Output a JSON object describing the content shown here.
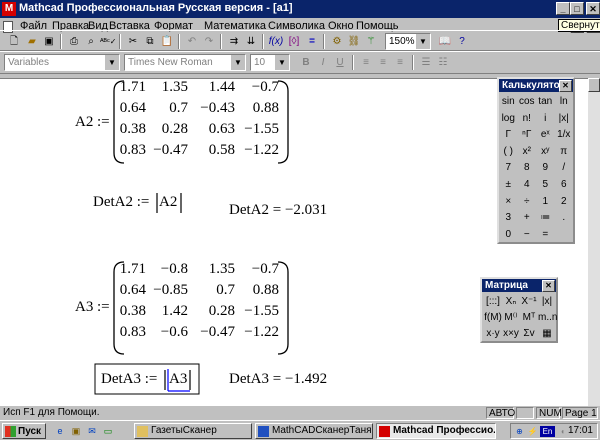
{
  "window": {
    "title": "Mathcad Профессиональная Русская версия - [a1]",
    "tooltip": "Свернуть"
  },
  "menu": [
    "Файл",
    "Правка",
    "Вид",
    "Вставка",
    "Формат",
    "Математика",
    "Символика",
    "Окно",
    "Помощь"
  ],
  "format_toolbar": {
    "style": "Variables",
    "font": "Times New Roman",
    "size": "10",
    "bold": "B",
    "italic": "I",
    "underline": "U"
  },
  "standard_toolbar": {
    "zoom": "150%"
  },
  "worksheet": {
    "a2": {
      "name": "A2",
      "assign": ":=",
      "rows": [
        [
          "1.71",
          "1.35",
          "1.44",
          "−0.7"
        ],
        [
          "0.64",
          "0.7",
          "−0.43",
          "0.88"
        ],
        [
          "0.38",
          "0.28",
          "0.63",
          "−1.55"
        ],
        [
          "0.83",
          "−0.47",
          "0.58",
          "−1.22"
        ]
      ]
    },
    "det_a2": {
      "def": "DetA2 :=",
      "arg": "A2",
      "result": "DetA2 = −2.031"
    },
    "a3": {
      "name": "A3",
      "assign": ":=",
      "rows": [
        [
          "1.71",
          "−0.8",
          "1.35",
          "−0.7"
        ],
        [
          "0.64",
          "−0.85",
          "0.7",
          "0.88"
        ],
        [
          "0.38",
          "1.42",
          "0.28",
          "−1.55"
        ],
        [
          "0.83",
          "−0.6",
          "−0.47",
          "−1.22"
        ]
      ]
    },
    "det_a3": {
      "def": "DetA3 :=",
      "arg": "A3",
      "result": "DetA3 = −1.492"
    }
  },
  "calculator": {
    "title": "Калькулятор",
    "keys": [
      [
        "sin",
        "cos",
        "tan",
        "ln"
      ],
      [
        "log",
        "n!",
        "i",
        "|x|"
      ],
      [
        "Γ",
        "ⁿΓ",
        "eˣ",
        "1/x"
      ],
      [
        "( )",
        "x²",
        "xʸ",
        "π"
      ],
      [
        "7",
        "8",
        "9",
        "/"
      ],
      [
        "±",
        "4",
        "5",
        "6"
      ],
      [
        "×",
        "÷",
        "1",
        "2"
      ],
      [
        "3",
        "+",
        "≔",
        "."
      ],
      [
        "0",
        "−",
        "="
      ]
    ]
  },
  "matrix_palette": {
    "title": "Матрица",
    "keys": [
      [
        "[:::]",
        "Xₙ",
        "X⁻¹",
        "|x|"
      ],
      [
        "f(M)",
        "M⁽⁾",
        "Mᵀ",
        "m..n"
      ],
      [
        "x·y",
        "x×y",
        "Σv",
        "▦"
      ]
    ]
  },
  "status": {
    "help": "Исп F1 для Помощи.",
    "mode": "АВТО",
    "num": "NUM",
    "page": "Page 1"
  },
  "taskbar": {
    "start": "Пуск",
    "tasks": [
      "ГазетыСканер",
      "MathCADСканерТаня - М...",
      "Mathcad Профессио..."
    ],
    "lang": "En",
    "clock": "17:01"
  }
}
